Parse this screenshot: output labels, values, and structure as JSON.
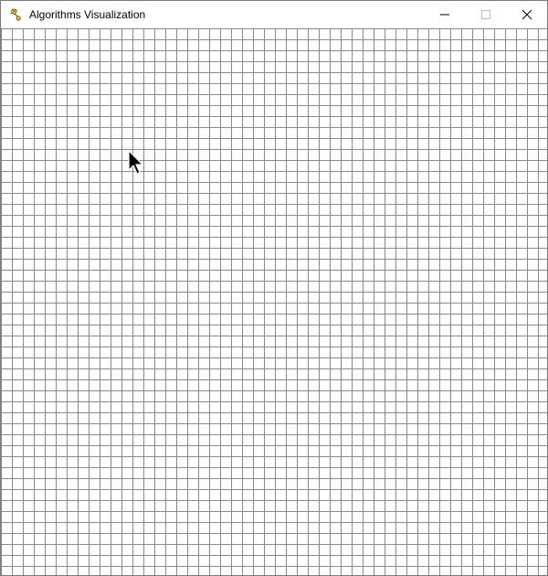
{
  "window": {
    "title": "Algorithms Visualization",
    "app_icon": "pygame-snake-icon",
    "buttons": {
      "minimize_icon": "minimize-icon",
      "maximize_icon": "maximize-icon",
      "close_icon": "close-icon"
    }
  },
  "canvas": {
    "grid": {
      "line_color": "#8a8a8a",
      "background_color": "#ffffff"
    },
    "cursor_icon": "arrow-cursor-icon"
  }
}
